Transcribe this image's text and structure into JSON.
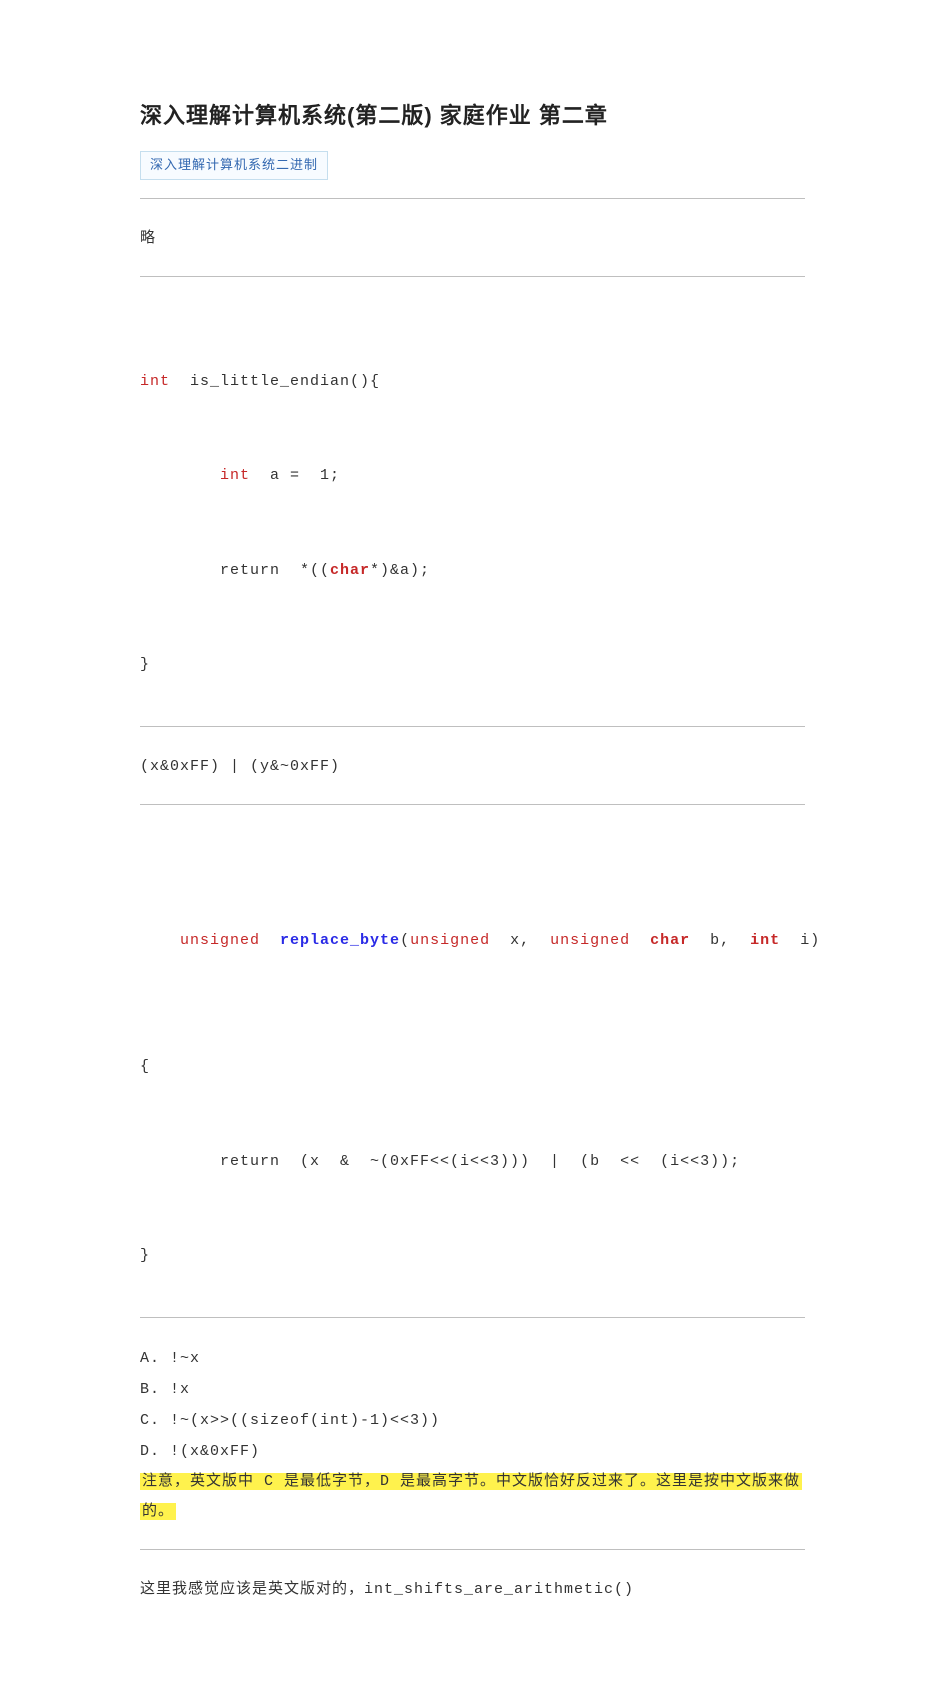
{
  "title": "深入理解计算机系统(第二版) 家庭作业 第二章",
  "tag": "深入理解计算机系统二进制",
  "omit": "略",
  "code1": {
    "l1_kw": "int",
    "l1_rest": "  is_little_endian(){",
    "l2_prefix": "        ",
    "l2_kw": "int",
    "l2_rest": "  a =  1;",
    "l3_prefix": "        return  *((",
    "l3_kw": "char",
    "l3_rest": "*)&a);",
    "l4": "}"
  },
  "expr1": "(x&0xFF) | (y&~0xFF)",
  "code2": {
    "l1_kw1": "unsigned",
    "l1_fn": "  replace_byte",
    "l1_p1": "(",
    "l1_kw2": "unsigned",
    "l1_p2": "  x,  ",
    "l1_kw3": "unsigned",
    "l1_p3": "  ",
    "l1_kw4": "char",
    "l1_p4": "  b,  ",
    "l1_kw5": "int",
    "l1_p5": "  i)",
    "l2": "{",
    "l3": "        return  (x  &  ~(0xFF<<(i<<3)))  |  (b  <<  (i<<3));",
    "l4": "}"
  },
  "answers": {
    "a": "A. !~x",
    "b": "B. !x",
    "c": "C. !~(x>>((sizeof(int)-1)<<3))",
    "d": "D. !(x&0xFF)"
  },
  "note_hl_1": "注意，英文版中 C 是最低字节，D 是最高字节。中文版恰好反过来了。这里是按中文版来做",
  "note_hl_2": "的。",
  "footer": "这里我感觉应该是英文版对的，int_shifts_are_arithmetic()"
}
